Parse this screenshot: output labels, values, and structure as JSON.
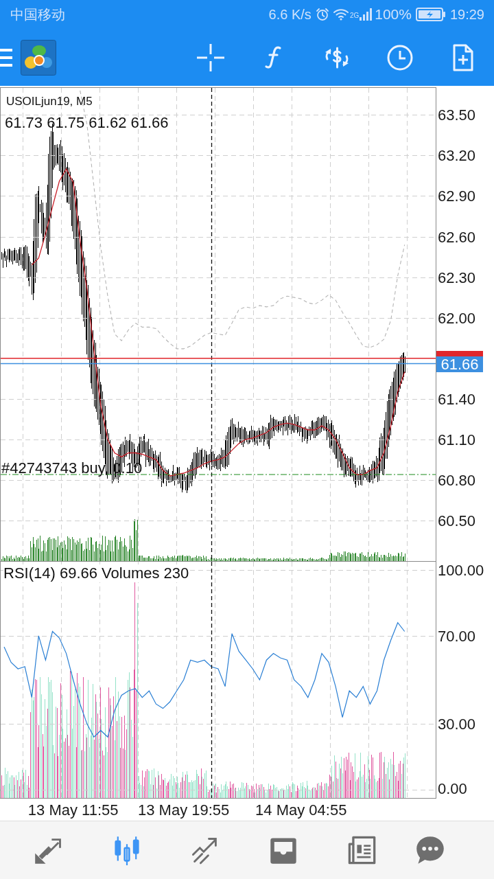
{
  "status_bar": {
    "carrier": "中国移动",
    "speed": "6.6 K/s",
    "network": "2G",
    "battery": "100%",
    "time": "19:29"
  },
  "main_chart": {
    "quote": "61.73 61.75 61.62 61.66",
    "chart_data": {
      "type": "line",
      "title": "USOILjun19, M5",
      "categories": [
        null,
        null,
        null,
        null,
        null,
        null,
        null,
        null,
        null,
        null,
        null,
        null,
        null,
        null,
        null,
        null,
        null,
        null,
        null,
        null,
        null,
        null,
        null,
        null,
        null,
        null,
        null,
        null,
        null,
        null,
        null,
        null,
        null,
        null,
        null,
        null,
        null,
        null,
        null,
        null,
        null,
        null,
        null,
        null,
        null,
        null,
        null,
        null,
        null,
        null,
        null,
        null,
        null,
        null,
        null,
        null,
        null,
        null,
        null,
        null,
        null,
        null,
        null
      ],
      "ylim": [
        60.2,
        63.7
      ],
      "yticks": [
        {
          "value": 63.5,
          "label": "63.50"
        },
        {
          "value": 63.2,
          "label": "63.20"
        },
        {
          "value": 62.9,
          "label": "62.90"
        },
        {
          "value": 62.6,
          "label": "62.60"
        },
        {
          "value": 62.3,
          "label": "62.30"
        },
        {
          "value": 62.0,
          "label": "62.00"
        },
        {
          "value": 61.4,
          "label": "61.40"
        },
        {
          "value": 61.1,
          "label": "61.10"
        },
        {
          "value": 60.8,
          "label": "60.80"
        },
        {
          "value": 60.5,
          "label": "60.50"
        }
      ],
      "grid": true,
      "series": [
        {
          "color": "#c8202a",
          "values": [
            null,
            null,
            null,
            null,
            62.39,
            62.44,
            62.62,
            62.82,
            63.01,
            63.1,
            63.0,
            62.57,
            62.21,
            61.76,
            61.35,
            61.1,
            61.0,
            60.97,
            61.0,
            61.0,
            60.99,
            60.97,
            60.95,
            60.87,
            60.83,
            60.84,
            60.85,
            60.87,
            60.89,
            60.92,
            60.94,
            60.95,
            60.97,
            61.02,
            61.07,
            61.1,
            61.11,
            61.13,
            61.15,
            61.19,
            61.21,
            61.22,
            61.21,
            61.19,
            61.17,
            61.17,
            61.2,
            61.17,
            61.1,
            61.0,
            60.89,
            60.84,
            60.84,
            60.87,
            60.89,
            61.0,
            61.2,
            61.45,
            61.6,
            null,
            null,
            null,
            null
          ]
        },
        {
          "color": "#b4b4b4",
          "line_style": "dashed",
          "values": [
            null,
            null,
            null,
            null,
            null,
            null,
            null,
            null,
            null,
            null,
            null,
            63.68,
            63.43,
            62.97,
            62.52,
            62.16,
            61.88,
            61.83,
            61.91,
            61.96,
            61.93,
            61.93,
            61.92,
            61.86,
            61.81,
            61.77,
            61.77,
            61.79,
            61.83,
            61.87,
            61.89,
            61.88,
            61.87,
            61.96,
            62.06,
            62.08,
            62.07,
            62.09,
            62.08,
            62.09,
            62.14,
            62.16,
            62.15,
            62.14,
            62.11,
            62.1,
            62.13,
            62.17,
            62.13,
            62.04,
            61.96,
            61.87,
            61.79,
            61.78,
            61.8,
            61.84,
            61.98,
            62.31,
            62.54,
            null,
            null,
            null,
            null
          ]
        }
      ],
      "ref_lines": [
        {
          "axis": "y",
          "value": 61.7,
          "color": "#e0262b"
        },
        {
          "axis": "y",
          "value": 61.66,
          "color": "#3d90e0",
          "label": "61.66"
        },
        {
          "axis": "y",
          "value": 60.84,
          "color": "#1d8a1d",
          "line_style": "dashdot",
          "label": "#42743743 buy, 0.10"
        }
      ]
    }
  },
  "rsi_chart": {
    "chart_data": {
      "type": "line",
      "title": "RSI(14) 69.66 Volumes 230",
      "categories": [
        null,
        null,
        null,
        null,
        null,
        null,
        null,
        null,
        null,
        null,
        "13 May 11:55",
        null,
        null,
        null,
        null,
        null,
        null,
        null,
        null,
        null,
        null,
        null,
        null,
        null,
        null,
        null,
        "13 May 19:55",
        null,
        null,
        null,
        null,
        null,
        null,
        null,
        null,
        null,
        null,
        null,
        null,
        null,
        null,
        null,
        null,
        "14 May 04:55",
        null,
        null,
        null,
        null,
        null,
        null,
        null,
        null,
        null,
        null,
        null,
        null,
        null,
        null,
        null,
        null,
        null,
        null,
        null
      ],
      "ylim": [
        -3.7,
        103.7
      ],
      "yticks": [
        {
          "value": 100,
          "label": "100.00"
        },
        {
          "value": 70,
          "label": "70.00"
        },
        {
          "value": 30,
          "label": "30.00"
        },
        {
          "value": 0,
          "label": "0.00"
        }
      ],
      "grid": true,
      "series": [
        {
          "color": "#2a7fd4",
          "values": [
            65,
            58,
            55,
            56,
            42,
            70,
            59,
            72,
            69,
            62,
            50,
            39,
            30,
            24,
            27,
            24,
            36,
            43,
            45,
            46,
            42,
            45,
            39,
            37,
            40,
            45,
            50,
            59,
            58,
            59,
            56,
            55,
            47,
            71,
            63,
            59,
            55,
            50,
            59,
            62,
            60,
            59,
            50,
            47,
            42,
            50,
            62,
            58,
            47,
            33,
            45,
            42,
            47,
            39,
            45,
            59,
            68,
            76,
            72,
            null,
            null,
            null,
            null
          ]
        }
      ]
    }
  },
  "bottom_nav": [
    {
      "selected": false
    },
    {
      "selected": true
    },
    {
      "selected": false
    },
    {
      "selected": false
    },
    {
      "selected": false
    },
    {
      "selected": false
    }
  ]
}
